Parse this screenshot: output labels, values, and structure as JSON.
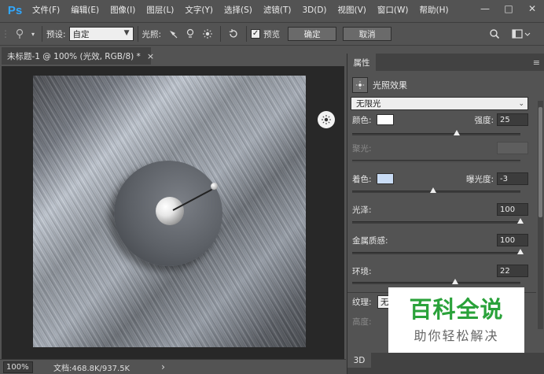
{
  "app": {
    "logo": "Ps"
  },
  "menu": [
    "文件(F)",
    "编辑(E)",
    "图像(I)",
    "图层(L)",
    "文字(Y)",
    "选择(S)",
    "滤镜(T)",
    "3D(D)",
    "视图(V)",
    "窗口(W)",
    "帮助(H)"
  ],
  "window_controls": {
    "minimize": "—",
    "restore": "□",
    "close": "✕"
  },
  "options": {
    "preset_label": "预设:",
    "preset_value": "自定",
    "lights_label": "光照:",
    "preview_label": "预览",
    "ok_label": "确定",
    "cancel_label": "取消"
  },
  "document": {
    "tab_title": "未标题-1 @ 100% (光效, RGB/8) *",
    "close": "×"
  },
  "status": {
    "zoom": "100%",
    "doc_info": "文档:468.8K/937.5K",
    "arrow": "›"
  },
  "properties": {
    "tab": "属性",
    "menu_icon": "≡",
    "title": "光照效果",
    "light_type": "无限光",
    "color_label": "颜色:",
    "color_value": "#ffffff",
    "intensity_label": "强度:",
    "intensity": "25",
    "intensity_fraction": 0.62,
    "hotspot_label": "聚光:",
    "colorize_label": "着色:",
    "colorize_value": "#c9dcf5",
    "exposure_label": "曝光度:",
    "exposure": "-3",
    "exposure_fraction": 0.48,
    "gloss_label": "光泽:",
    "gloss": "100",
    "gloss_fraction": 1.0,
    "metallic_label": "金属质感:",
    "metallic": "100",
    "metallic_fraction": 1.0,
    "ambience_label": "环境:",
    "ambience": "22",
    "ambience_fraction": 0.61,
    "texture_label": "纹理:",
    "texture_value": "无",
    "height_label": "高度:"
  },
  "bottom_panel": {
    "tab": "3D"
  },
  "watermark": {
    "main": "百科全说",
    "sub": "助你轻松解决"
  },
  "colors": {
    "ui_bg": "#535353",
    "canvas_bg": "#282828",
    "accent": "#31a8ff",
    "watermark_green": "#2aa23a"
  }
}
